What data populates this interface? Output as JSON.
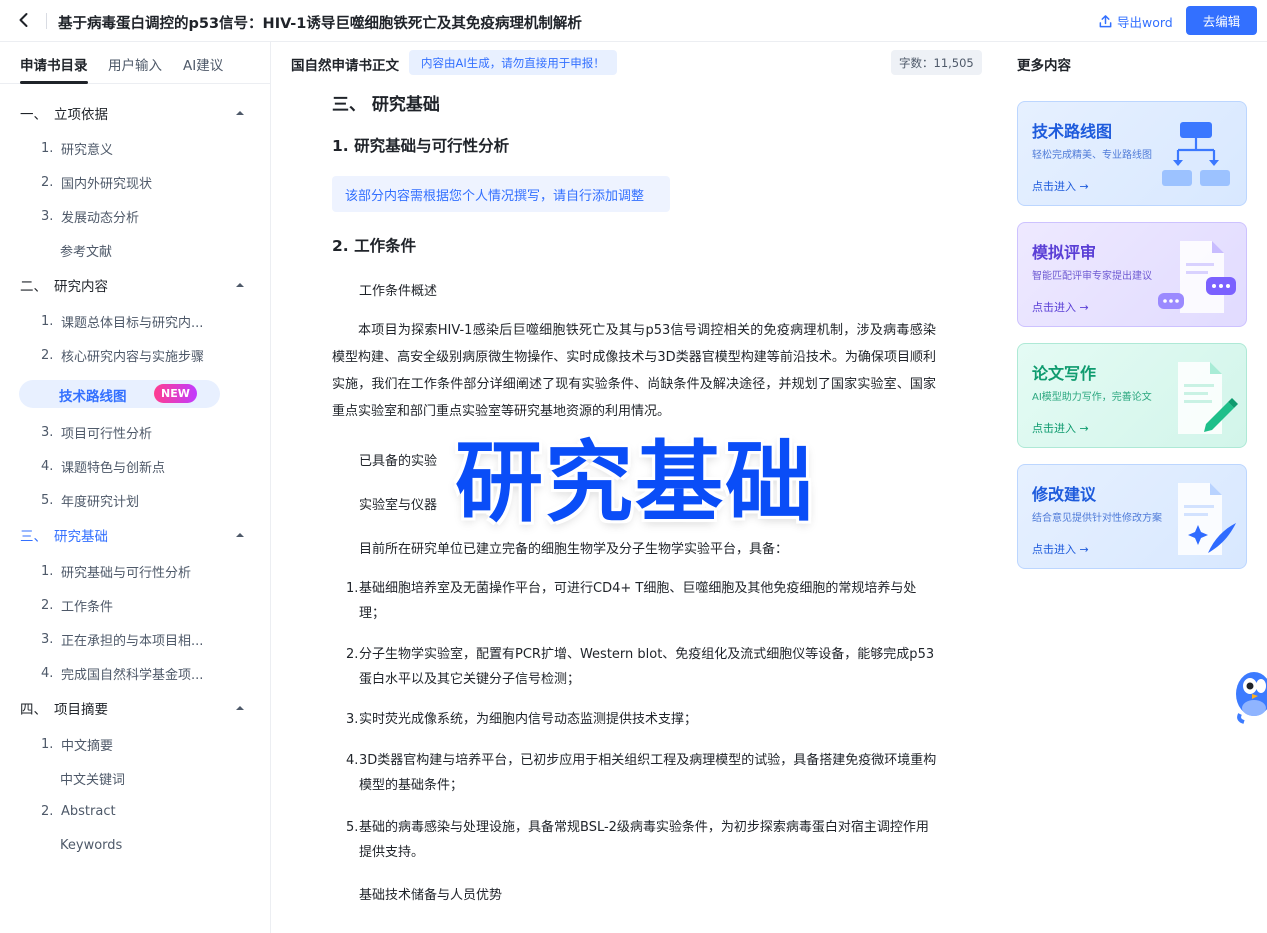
{
  "header": {
    "title": "基于病毒蛋白调控的p53信号：HIV-1诱导巨噬细胞铁死亡及其免疫病理机制解析",
    "export_label": "导出word",
    "edit_label": "去编辑"
  },
  "sidebar": {
    "tabs": [
      "申请书目录",
      "用户输入",
      "AI建议"
    ],
    "sections": [
      {
        "num": "一、",
        "label": "立项依据",
        "items": [
          {
            "num": "1.",
            "label": "研究意义"
          },
          {
            "num": "2.",
            "label": "国内外研究现状"
          },
          {
            "num": "3.",
            "label": "发展动态分析"
          },
          {
            "num": "",
            "label": "参考文献"
          }
        ]
      },
      {
        "num": "二、",
        "label": "研究内容",
        "items": [
          {
            "num": "1.",
            "label": "课题总体目标与研究内..."
          },
          {
            "num": "2.",
            "label": "核心研究内容与实施步骤"
          },
          {
            "num": "3.",
            "label": "项目可行性分析"
          },
          {
            "num": "4.",
            "label": "课题特色与创新点"
          },
          {
            "num": "5.",
            "label": "年度研究计划"
          }
        ]
      },
      {
        "num": "三、",
        "label": "研究基础",
        "items": [
          {
            "num": "1.",
            "label": "研究基础与可行性分析"
          },
          {
            "num": "2.",
            "label": "工作条件"
          },
          {
            "num": "3.",
            "label": "正在承担的与本项目相..."
          },
          {
            "num": "4.",
            "label": "完成国自然科学基金项..."
          }
        ]
      },
      {
        "num": "四、",
        "label": "项目摘要",
        "items": [
          {
            "num": "1.",
            "label": "中文摘要"
          },
          {
            "num": "",
            "label": "中文关键词"
          },
          {
            "num": "2.",
            "label": "Abstract"
          },
          {
            "num": "",
            "label": "Keywords"
          }
        ]
      }
    ],
    "roadmap_label": "技术路线图",
    "new_badge": "NEW"
  },
  "main": {
    "header_title": "国自然申请书正文",
    "ai_notice": "内容由AI生成，请勿直接用于申报！",
    "word_count": "字数：11,505",
    "h1": "三、 研究基础",
    "h2_1": "1. 研究基础与可行性分析",
    "hint": "该部分内容需根据您个人情况撰写，请自行添加调整",
    "h2_2": "2. 工作条件",
    "sub_overview": "工作条件概述",
    "para1": "本项目为探索HIV-1感染后巨噬细胞铁死亡及其与p53信号调控相关的免疫病理机制，涉及病毒感染模型构建、高安全级别病原微生物操作、实时成像技术与3D类器官模型构建等前沿技术。为确保项目顺利实施，我们在工作条件部分详细阐述了现有实验条件、尚缺条件及解决途径，并规划了国家实验室、国家重点实验室和部门重点实验室等研究基地资源的利用情况。",
    "sub_existing": "已具备的实验",
    "sub_lab": "实验室与仪器",
    "para2": "目前所在研究单位已建立完备的细胞生物学及分子生物学实验平台，具备：",
    "list": [
      {
        "num": "1.",
        "text": "基础细胞培养室及无菌操作平台，可进行CD4+ T细胞、巨噬细胞及其他免疫细胞的常规培养与处理；"
      },
      {
        "num": "2.",
        "text": "分子生物学实验室，配置有PCR扩增、Western blot、免疫组化及流式细胞仪等设备，能够完成p53蛋白水平以及其它关键分子信号检测；"
      },
      {
        "num": "3.",
        "text": "实时荧光成像系统，为细胞内信号动态监测提供技术支撑；"
      },
      {
        "num": "4.",
        "text": "3D类器官构建与培养平台，已初步应用于相关组织工程及病理模型的试验，具备搭建免疫微环境重构模型的基础条件；"
      },
      {
        "num": "5.",
        "text": "基础的病毒感染与处理设施，具备常规BSL-2级病毒实验条件，为初步探索病毒蛋白对宿主调控作用提供支持。"
      }
    ],
    "sub_tech": "基础技术储备与人员优势",
    "overlay": "研究基础"
  },
  "right_panel": {
    "title": "更多内容",
    "cards": [
      {
        "title": "技术路线图",
        "desc": "轻松完成精美、专业路线图",
        "link": "点击进入 →",
        "icon": "flowchart-icon"
      },
      {
        "title": "模拟评审",
        "desc": "智能匹配评审专家提出建议",
        "link": "点击进入 →",
        "icon": "review-chat-icon"
      },
      {
        "title": "论文写作",
        "desc": "AI模型助力写作，完善论文",
        "link": "点击进入 →",
        "icon": "document-pen-icon"
      },
      {
        "title": "修改建议",
        "desc": "结合意见提供针对性修改方案",
        "link": "点击进入 →",
        "icon": "document-sparkle-icon"
      }
    ]
  },
  "colors": {
    "accent": "#3370ff",
    "overlay": "#0a4df7",
    "new_badge": "#ff3d8f"
  }
}
